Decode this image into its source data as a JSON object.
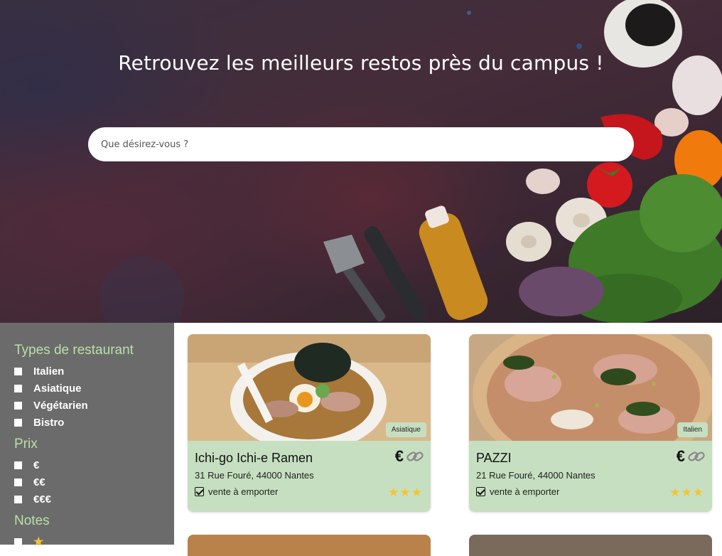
{
  "hero": {
    "title": "Retrouvez les meilleurs restos près du campus !",
    "search_placeholder": "Que désirez-vous ?"
  },
  "sidebar": {
    "groups": [
      {
        "heading": "Types de restaurant",
        "options": [
          "Italien",
          "Asiatique",
          "Végétarien",
          "Bistro"
        ]
      },
      {
        "heading": "Prix",
        "options": [
          "€",
          "€€",
          "€€€"
        ]
      },
      {
        "heading": "Notes",
        "options": [
          "★"
        ]
      }
    ]
  },
  "restaurants": [
    {
      "name": "Ichi-go Ichi-e Ramen",
      "type": "Asiatique",
      "price": "€",
      "address": "31 Rue Fouré, 44000 Nantes",
      "takeaway": "vente à emporter",
      "rating": 3,
      "photo_icon": "ramen-bowl"
    },
    {
      "name": "PAZZI",
      "type": "Italien",
      "price": "€",
      "address": "21 Rue Fouré, 44000 Nantes",
      "takeaway": "vente à emporter",
      "rating": 3,
      "photo_icon": "pizza"
    }
  ],
  "colors": {
    "accent_green": "#b8e0a6",
    "card_bg": "#c6dfc0",
    "sidebar_bg": "#6b6b6b",
    "star": "#f4c430"
  }
}
